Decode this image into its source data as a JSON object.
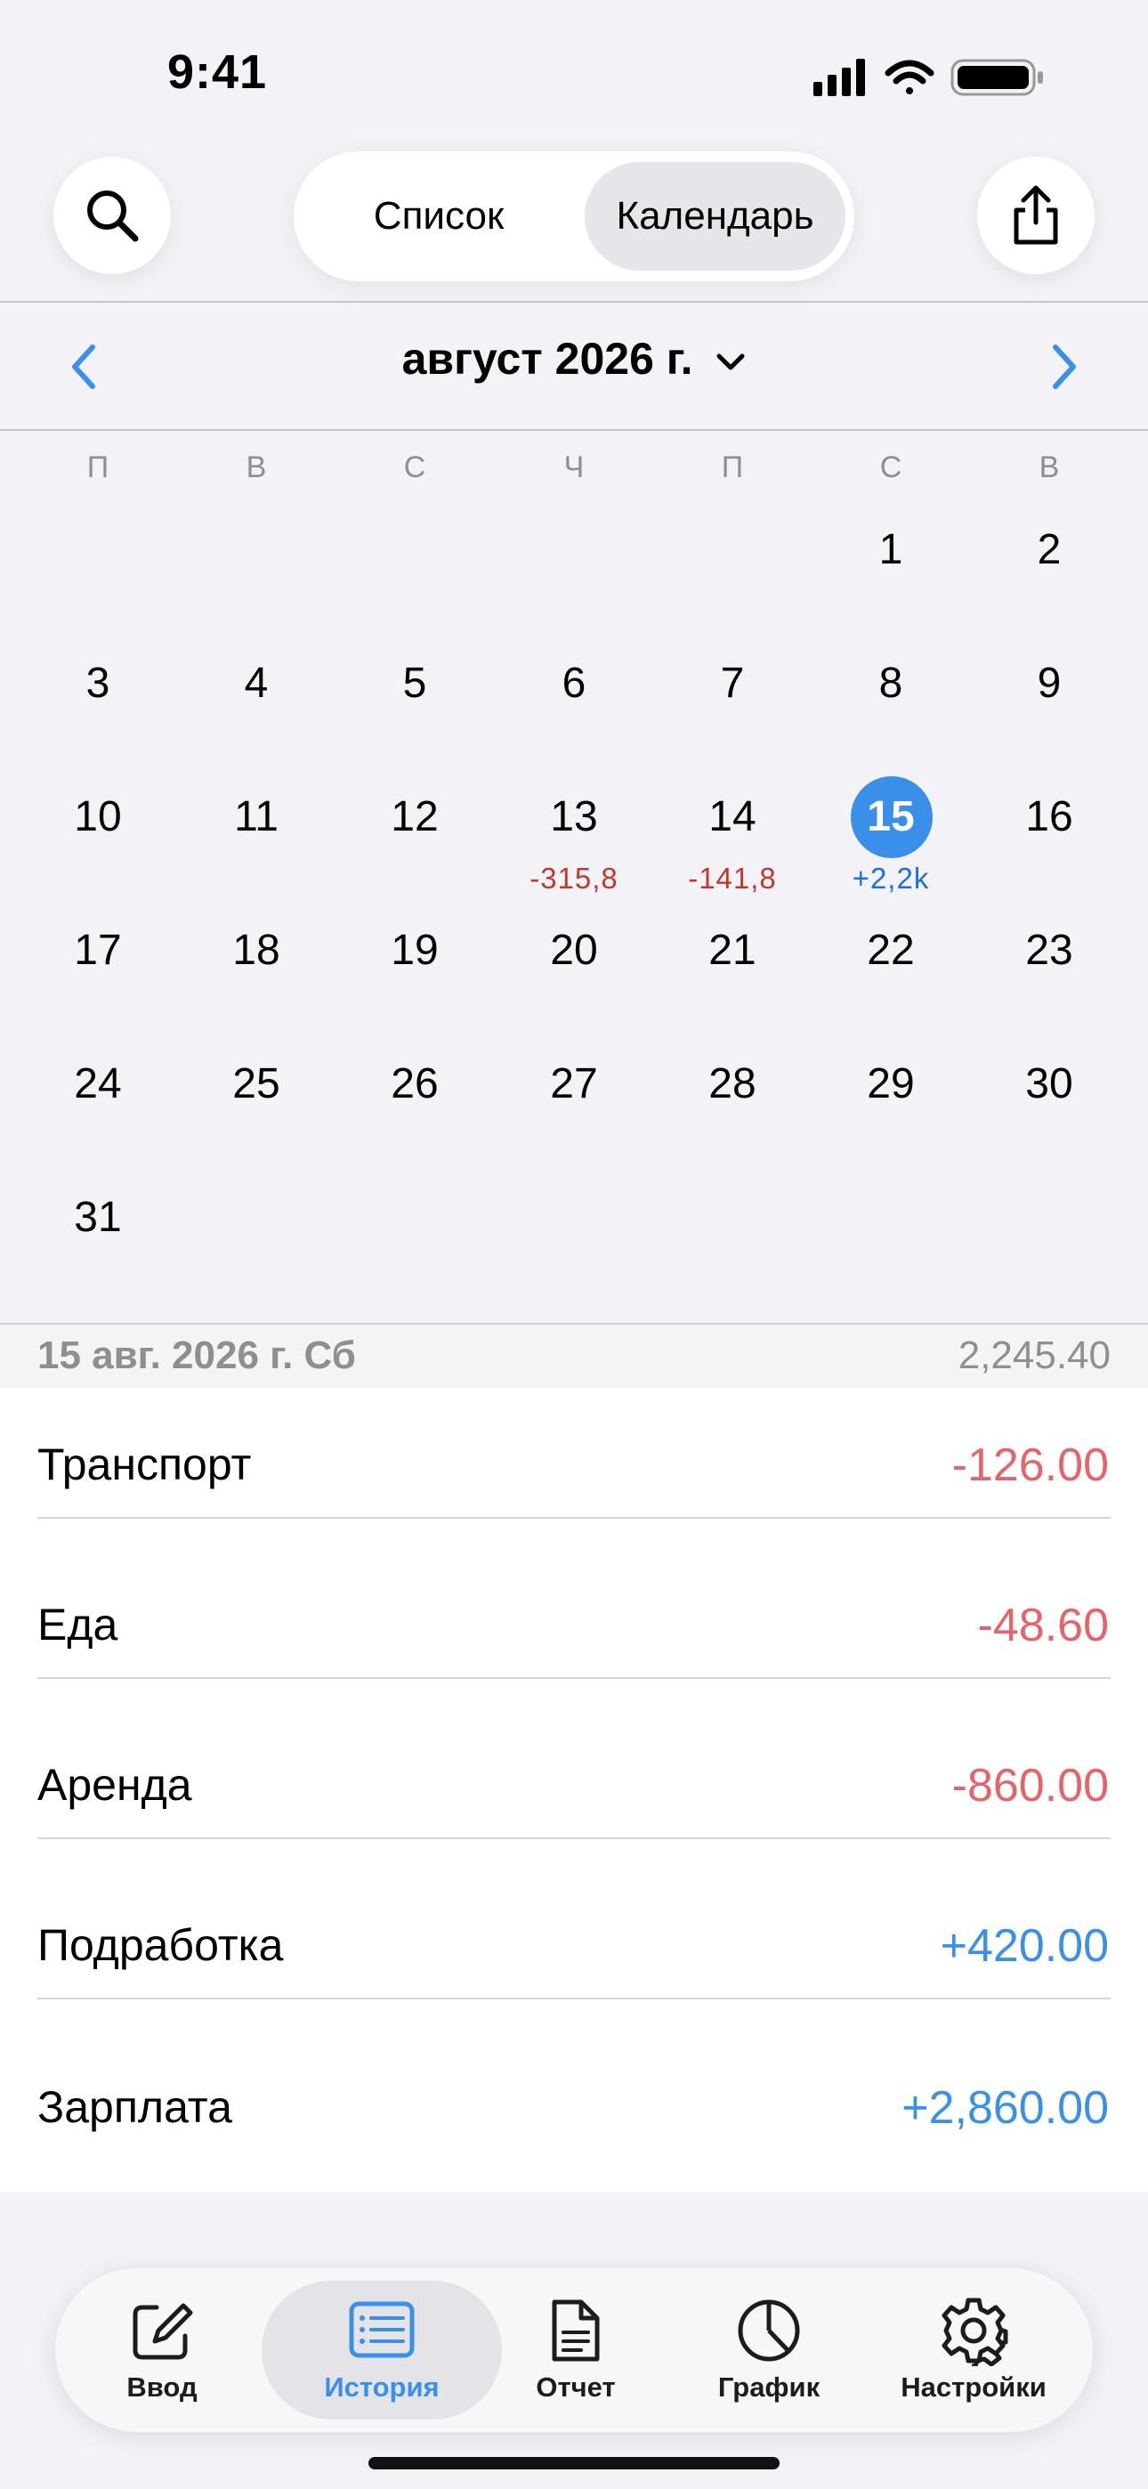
{
  "status_bar": {
    "time": "9:41"
  },
  "header": {
    "segments": [
      "Список",
      "Календарь"
    ],
    "selected_segment": "Календарь"
  },
  "calendar": {
    "month_title": "август 2026 г.",
    "weekdays": [
      "П",
      "В",
      "С",
      "Ч",
      "П",
      "С",
      "В"
    ],
    "selected_day": "15",
    "days": [
      "1",
      "2",
      "3",
      "4",
      "5",
      "6",
      "7",
      "8",
      "9",
      "10",
      "11",
      "12",
      "13",
      "14",
      "15",
      "16",
      "17",
      "18",
      "19",
      "20",
      "21",
      "22",
      "23",
      "24",
      "25",
      "26",
      "27",
      "28",
      "29",
      "30",
      "31"
    ],
    "amounts": {
      "13": "-315,8",
      "14": "-141,8",
      "15": "+2,2k"
    }
  },
  "selected_date": {
    "label": "15 авг. 2026 г. Сб",
    "total": "2,245.40"
  },
  "transactions": [
    {
      "name": "Транспорт",
      "amount": "-126.00",
      "type": "expense"
    },
    {
      "name": "Еда",
      "amount": "-48.60",
      "type": "expense"
    },
    {
      "name": "Аренда",
      "amount": "-860.00",
      "type": "expense"
    },
    {
      "name": "Подработка",
      "amount": "+420.00",
      "type": "income"
    },
    {
      "name": "Зарплата",
      "amount": "+2,860.00",
      "type": "income"
    }
  ],
  "tabs": [
    {
      "label": "Ввод",
      "icon": "compose-icon"
    },
    {
      "label": "История",
      "icon": "list-icon",
      "active": true
    },
    {
      "label": "Отчет",
      "icon": "document-icon"
    },
    {
      "label": "График",
      "icon": "pie-chart-icon"
    },
    {
      "label": "Настройки",
      "icon": "gear-icon"
    }
  ],
  "colors": {
    "accent": "#3a8fe8",
    "expense": "#e5646a",
    "income": "#3a8fe8",
    "calendar_negative": "#c0392b"
  }
}
